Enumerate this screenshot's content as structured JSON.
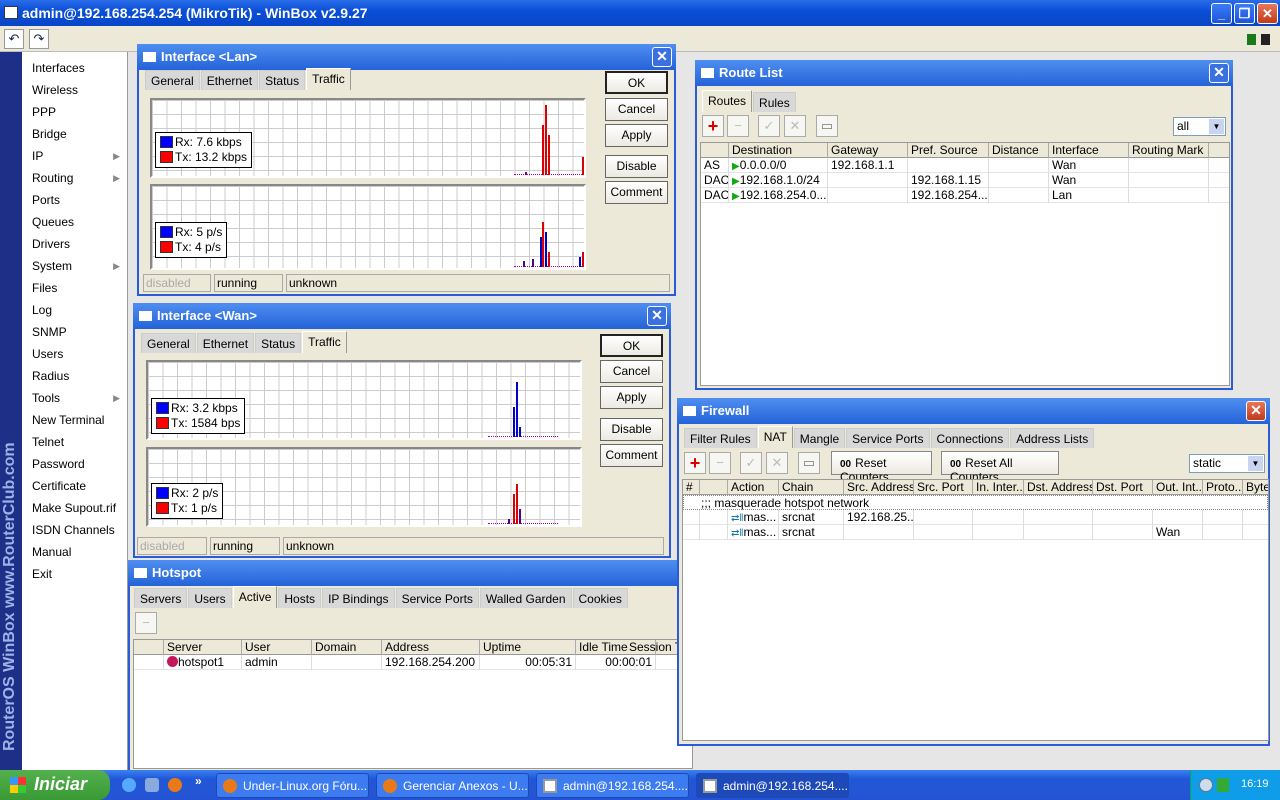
{
  "app": {
    "title": "admin@192.168.254.254 (MikroTik) - WinBox v2.9.27",
    "brand_strip": "RouterOS WinBox   www.RouterClub.com"
  },
  "menu": [
    {
      "label": "Interfaces"
    },
    {
      "label": "Wireless"
    },
    {
      "label": "PPP"
    },
    {
      "label": "Bridge"
    },
    {
      "label": "IP",
      "sub": true
    },
    {
      "label": "Routing",
      "sub": true
    },
    {
      "label": "Ports"
    },
    {
      "label": "Queues"
    },
    {
      "label": "Drivers"
    },
    {
      "label": "System",
      "sub": true
    },
    {
      "label": "Files"
    },
    {
      "label": "Log"
    },
    {
      "label": "SNMP"
    },
    {
      "label": "Users"
    },
    {
      "label": "Radius"
    },
    {
      "label": "Tools",
      "sub": true
    },
    {
      "label": "New Terminal"
    },
    {
      "label": "Telnet"
    },
    {
      "label": "Password"
    },
    {
      "label": "Certificate"
    },
    {
      "label": "Make Supout.rif"
    },
    {
      "label": "ISDN Channels"
    },
    {
      "label": "Manual"
    },
    {
      "label": "Exit"
    }
  ],
  "lan": {
    "title": "Interface <Lan>",
    "tabs": [
      "General",
      "Ethernet",
      "Status",
      "Traffic"
    ],
    "rx_bps": "Rx: 7.6 kbps",
    "tx_bps": "Tx: 13.2 kbps",
    "rx_pps": "Rx: 5 p/s",
    "tx_pps": "Tx: 4 p/s",
    "status": [
      "disabled",
      "running",
      "unknown"
    ]
  },
  "wan": {
    "title": "Interface <Wan>",
    "tabs": [
      "General",
      "Ethernet",
      "Status",
      "Traffic"
    ],
    "rx_bps": "Rx: 3.2 kbps",
    "tx_bps": "Tx: 1584 bps",
    "rx_pps": "Rx: 2 p/s",
    "tx_pps": "Tx: 1 p/s",
    "status": [
      "disabled",
      "running",
      "unknown"
    ]
  },
  "buttons": {
    "ok": "OK",
    "cancel": "Cancel",
    "apply": "Apply",
    "disable": "Disable",
    "comment": "Comment"
  },
  "routes": {
    "title": "Route List",
    "tabs": [
      "Routes",
      "Rules"
    ],
    "filter": "all",
    "columns": [
      "",
      "Destination",
      "Gateway",
      "Pref. Source",
      "Distance",
      "Interface",
      "Routing Mark"
    ],
    "rows": [
      [
        "AS",
        "0.0.0.0/0",
        "192.168.1.1",
        "",
        "",
        "Wan",
        ""
      ],
      [
        "DAC",
        "192.168.1.0/24",
        "",
        "192.168.1.15",
        "",
        "Wan",
        ""
      ],
      [
        "DAC",
        "192.168.254.0...",
        "",
        "192.168.254....",
        "",
        "Lan",
        ""
      ]
    ]
  },
  "firewall": {
    "title": "Firewall",
    "tabs": [
      "Filter Rules",
      "NAT",
      "Mangle",
      "Service Ports",
      "Connections",
      "Address Lists"
    ],
    "reset": "Reset Counters",
    "reset_all": "Reset All Counters",
    "counter_icon": "00",
    "filter": "static",
    "columns": [
      "#",
      "",
      "Action",
      "Chain",
      "Src. Address",
      "Src. Port",
      "In. Inter...",
      "Dst. Address",
      "Dst. Port",
      "Out. Int...",
      "Proto...",
      "Byte"
    ],
    "comment": ";;; masquerade hotspot network",
    "rows": [
      [
        "",
        "",
        "mas...",
        "srcnat",
        "192.168.25...",
        "",
        "",
        "",
        "",
        "",
        "",
        ""
      ],
      [
        "",
        "",
        "mas...",
        "srcnat",
        "",
        "",
        "",
        "",
        "",
        "Wan",
        "",
        ""
      ]
    ]
  },
  "hotspot": {
    "title": "Hotspot",
    "tabs": [
      "Servers",
      "Users",
      "Active",
      "Hosts",
      "IP Bindings",
      "Service Ports",
      "Walled Garden",
      "Cookies"
    ],
    "columns": [
      "",
      "Server",
      "User",
      "Domain",
      "Address",
      "Uptime",
      "Idle Time",
      "Session Ti"
    ],
    "rows": [
      [
        "",
        "hotspot1",
        "admin",
        "",
        "192.168.254.200",
        "00:05:31",
        "00:00:01",
        ""
      ]
    ]
  },
  "taskbar": {
    "start": "Iniciar",
    "tasks": [
      "Under-Linux.org Fóru...",
      "Gerenciar Anexos - U...",
      "admin@192.168.254....",
      "admin@192.168.254...."
    ],
    "clock": "16:19",
    "more": "»"
  }
}
